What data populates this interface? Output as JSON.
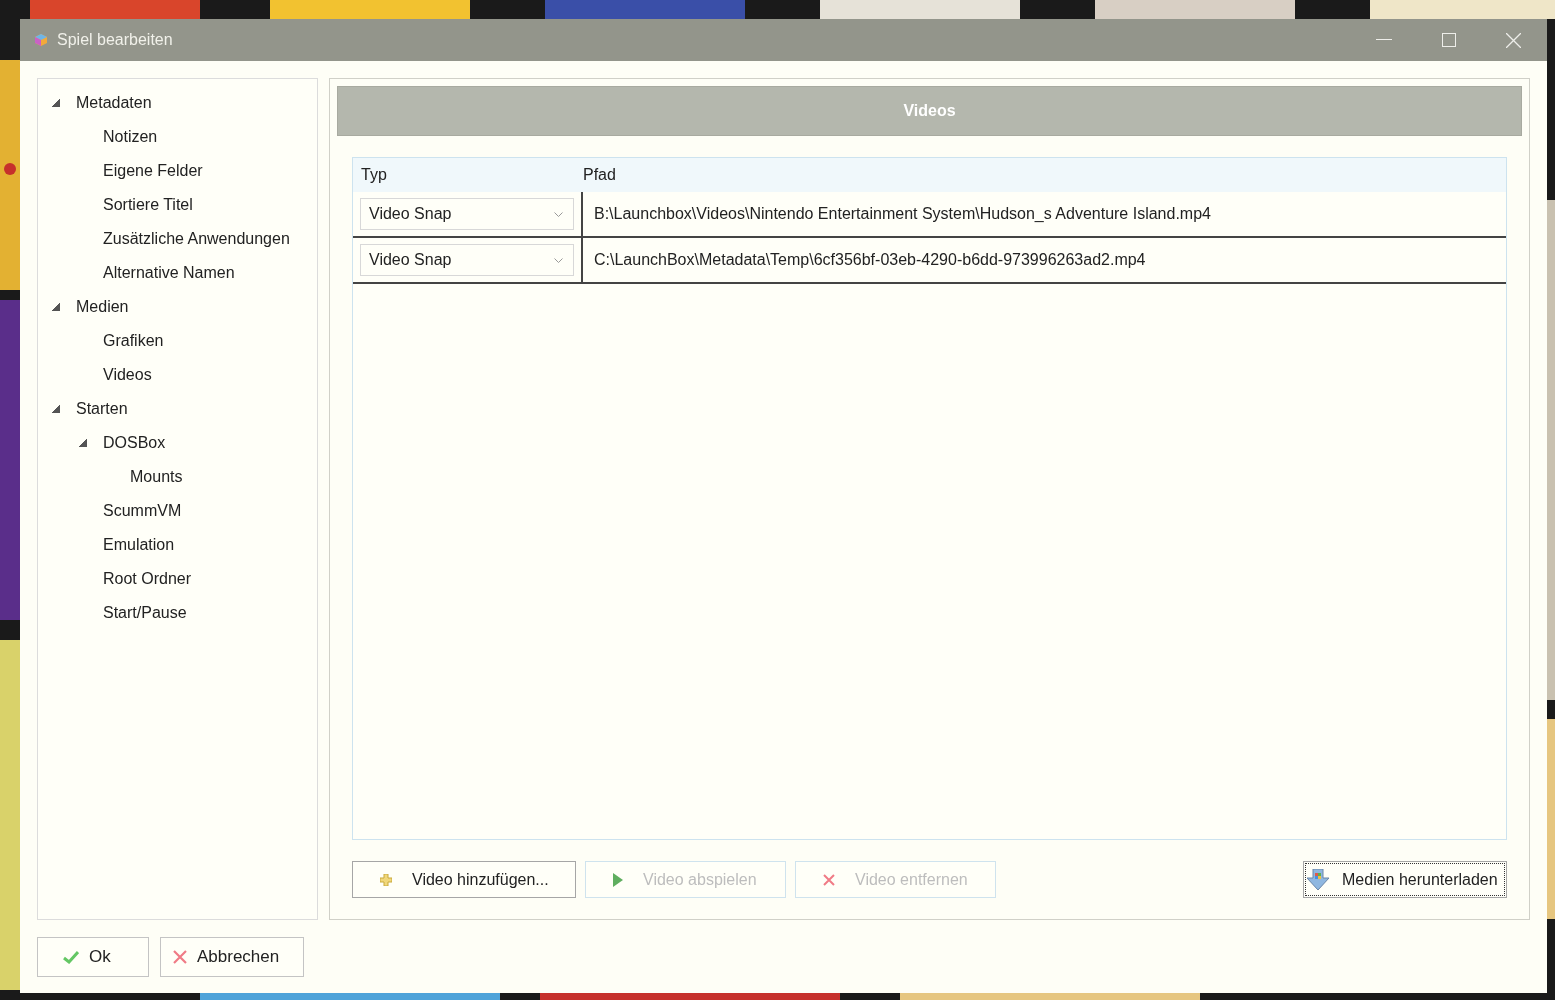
{
  "window": {
    "title": "Spiel bearbeiten"
  },
  "tree": [
    {
      "label": "Metadaten",
      "expanded": true,
      "children": [
        {
          "label": "Notizen"
        },
        {
          "label": "Eigene Felder"
        },
        {
          "label": "Sortiere Titel"
        },
        {
          "label": "Zusätzliche Anwendungen"
        },
        {
          "label": "Alternative Namen"
        }
      ]
    },
    {
      "label": "Medien",
      "expanded": true,
      "children": [
        {
          "label": "Grafiken"
        },
        {
          "label": "Videos"
        }
      ]
    },
    {
      "label": "Starten",
      "expanded": true,
      "children": [
        {
          "label": "DOSBox",
          "expanded": true,
          "children": [
            {
              "label": "Mounts"
            }
          ]
        },
        {
          "label": "ScummVM"
        },
        {
          "label": "Emulation"
        },
        {
          "label": "Root Ordner"
        },
        {
          "label": "Start/Pause"
        }
      ]
    }
  ],
  "section_title": "Videos",
  "table": {
    "columns": [
      "Typ",
      "Pfad"
    ],
    "rows": [
      {
        "type": "Video Snap",
        "path": "B:\\Launchbox\\Videos\\Nintendo Entertainment System\\Hudson_s Adventure Island.mp4"
      },
      {
        "type": "Video Snap",
        "path": "C:\\LaunchBox\\Metadata\\Temp\\6cf356bf-03eb-4290-b6dd-973996263ad2.mp4"
      }
    ]
  },
  "actions": [
    {
      "label": "Video hinzufügen...",
      "kind": "add",
      "disabled": false
    },
    {
      "label": "Video abspielen",
      "kind": "play",
      "disabled": true
    },
    {
      "label": "Video entfernen",
      "kind": "remove",
      "disabled": true
    }
  ],
  "download_button": {
    "label": "Medien herunterladen",
    "kind": "download"
  },
  "footer_buttons": [
    {
      "label": "Ok",
      "kind": "ok"
    },
    {
      "label": "Abbrechen",
      "kind": "cancel"
    }
  ]
}
